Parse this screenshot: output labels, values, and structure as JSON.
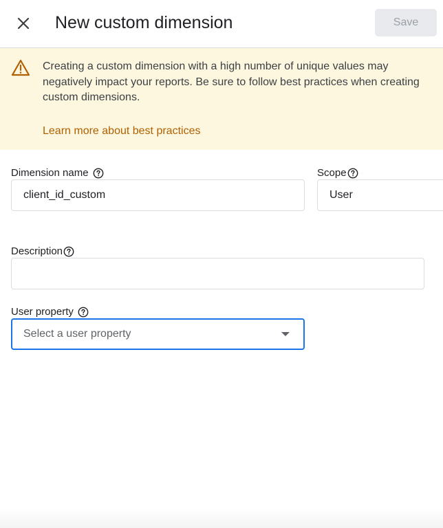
{
  "header": {
    "title": "New custom dimension",
    "save_label": "Save",
    "close_icon": "close-icon"
  },
  "banner": {
    "icon": "warning-icon",
    "message": "Creating a custom dimension with a high number of unique values may negatively impact your reports. Be sure to follow best practices when creating custom dimensions.",
    "link_label": "Learn more about best practices",
    "background": "#fef7e0",
    "link_color": "#b06000"
  },
  "form": {
    "dimension_name": {
      "label": "Dimension name",
      "value": "client_id_custom"
    },
    "scope": {
      "label": "Scope",
      "value": "User"
    },
    "description": {
      "label": "Description",
      "value": ""
    },
    "user_property": {
      "label": "User property",
      "placeholder": "Select a user property"
    }
  },
  "colors": {
    "accent": "#1a73e8",
    "disabled_button_bg": "#e8eaed",
    "disabled_button_text": "#9aa0a6"
  }
}
